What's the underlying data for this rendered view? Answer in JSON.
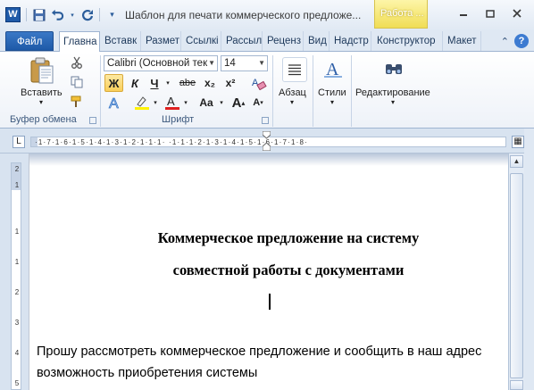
{
  "window": {
    "title": "Шаблон для печати коммерческого предложе...",
    "context_tab": "Работа ...",
    "minimize": "▭",
    "restore": "◻",
    "close": "✕"
  },
  "qat": {
    "app_icon": "W",
    "save_icon": "save-icon",
    "undo_icon": "undo-icon",
    "redo_icon": "redo-icon",
    "customize_icon": "dropdown-icon"
  },
  "tabs": [
    {
      "label": "Файл"
    },
    {
      "label": "Главна"
    },
    {
      "label": "Вставк"
    },
    {
      "label": "Размет"
    },
    {
      "label": "Ссылкі"
    },
    {
      "label": "Рассыл"
    },
    {
      "label": "Реценз"
    },
    {
      "label": "Вид"
    },
    {
      "label": "Надстр"
    },
    {
      "label": "Конструктор"
    },
    {
      "label": "Макет"
    }
  ],
  "ribbon": {
    "clipboard": {
      "paste_label": "Вставить",
      "group_label": "Буфер обмена"
    },
    "font": {
      "font_name": "Calibri (Основной тек",
      "font_size": "14",
      "bold": "Ж",
      "italic": "К",
      "underline": "Ч",
      "strikethrough": "abe",
      "subscript": "x₂",
      "superscript": "x²",
      "change_case": "Aa",
      "grow_font": "A",
      "shrink_font": "A",
      "group_label": "Шрифт"
    },
    "paragraph": {
      "label": "Абзац"
    },
    "styles": {
      "label": "Стили"
    },
    "editing": {
      "label": "Редактирование"
    }
  },
  "ruler": {
    "numbers": "·1·7·1·6·1·5·1·4·1·3·1·2·1·1·1·  ·1·1·1·2·1·3·1·4·1·5·1·6·1·7·1·8·",
    "vertical_numbers": [
      "2",
      "1",
      "1",
      "1",
      "2",
      "3",
      "4",
      "5"
    ]
  },
  "document": {
    "title_line1": "Коммерческое предложение на систему",
    "title_line2": "совместной работы с документами",
    "body_line1": "Прошу рассмотреть коммерческое предложение и сообщить в наш адрес",
    "body_line2": "возможность приобретения системы"
  }
}
